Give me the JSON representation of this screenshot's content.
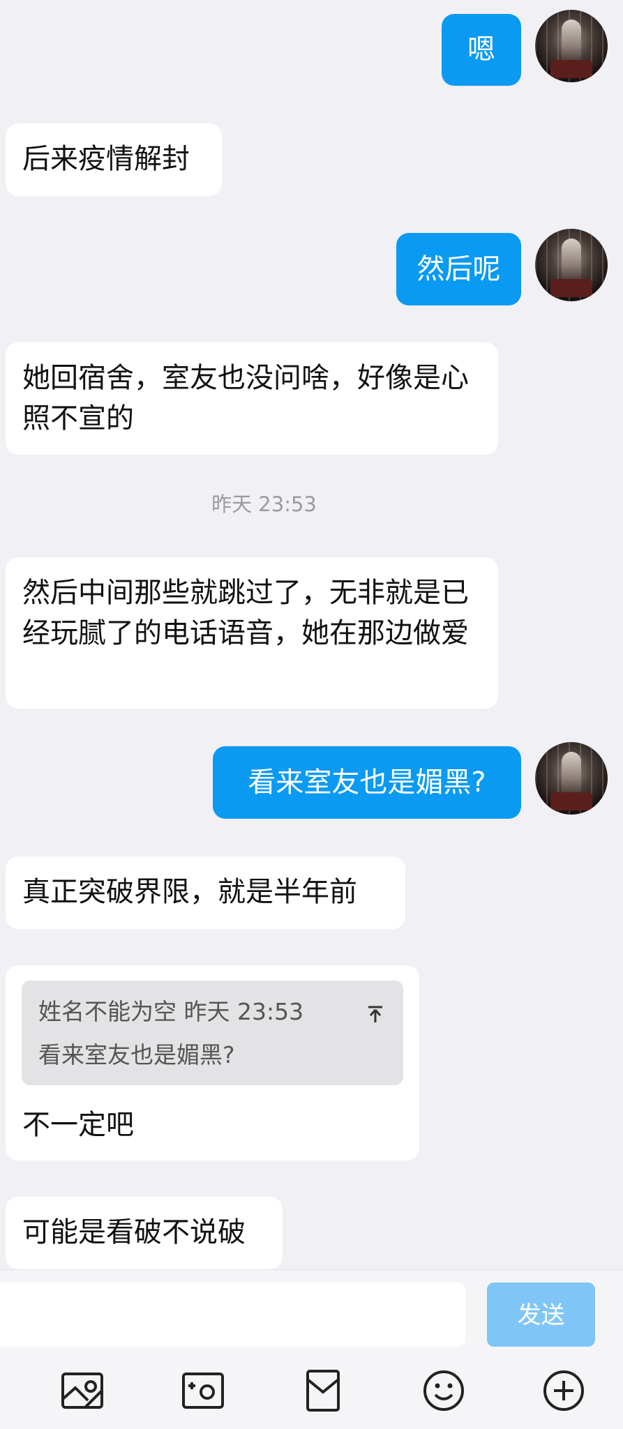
{
  "messages": [
    {
      "side": "out",
      "text": "嗯"
    },
    {
      "side": "in",
      "text": "后来疫情解封"
    },
    {
      "side": "out",
      "text": "然后呢"
    },
    {
      "side": "in",
      "text": "她回宿舍，室友也没问啥，好像是心照不宣的"
    },
    {
      "side": "in",
      "text": "然后中间那些就跳过了，无非就是已经玩腻了的电话语音，她在那边做爱"
    },
    {
      "side": "out",
      "text": "看来室友也是媚黑?"
    },
    {
      "side": "in",
      "text": "真正突破界限，就是半年前"
    },
    {
      "side": "in",
      "text": "不一定吧"
    },
    {
      "side": "in",
      "text": "可能是看破不说破"
    }
  ],
  "timestamp": "昨天 23:53",
  "quote": {
    "author": "姓名不能为空",
    "time": "昨天 23:53",
    "text": "看来室友也是媚黑?",
    "arrow_icon": "arrow-up-icon"
  },
  "input": {
    "value": "",
    "send_label": "发送"
  },
  "toolbar": {
    "icons": [
      "image-icon",
      "camera-icon",
      "red-packet-icon",
      "emoji-icon",
      "plus-icon"
    ]
  },
  "colors": {
    "outgoing_bubble": "#0a9af2",
    "incoming_bubble": "#ffffff",
    "send_button": "#7fc6f7",
    "background": "#f0f0f5"
  }
}
